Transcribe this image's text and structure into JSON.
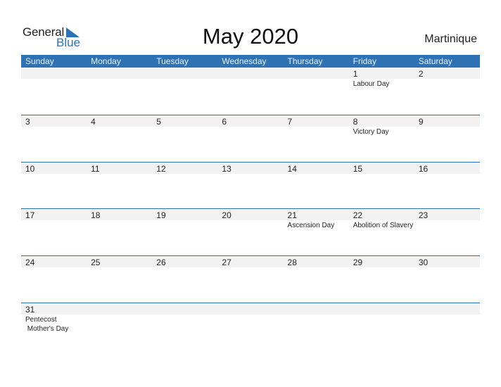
{
  "logo": {
    "line1": "General",
    "line2": "Blue",
    "accent": "#2a74b8"
  },
  "title": "May 2020",
  "country": "Martinique",
  "colors": {
    "header_bg": "#2e72b4",
    "number_row_bg": "#f2f2f2"
  },
  "weekdays": [
    "Sunday",
    "Monday",
    "Tuesday",
    "Wednesday",
    "Thursday",
    "Friday",
    "Saturday"
  ],
  "weeks": [
    {
      "days": [
        {
          "num": "",
          "events": []
        },
        {
          "num": "",
          "events": []
        },
        {
          "num": "",
          "events": []
        },
        {
          "num": "",
          "events": []
        },
        {
          "num": "",
          "events": []
        },
        {
          "num": "1",
          "events": [
            "Labour Day"
          ]
        },
        {
          "num": "2",
          "events": []
        }
      ]
    },
    {
      "days": [
        {
          "num": "3",
          "events": []
        },
        {
          "num": "4",
          "events": []
        },
        {
          "num": "5",
          "events": []
        },
        {
          "num": "6",
          "events": []
        },
        {
          "num": "7",
          "events": []
        },
        {
          "num": "8",
          "events": [
            "Victory Day"
          ]
        },
        {
          "num": "9",
          "events": []
        }
      ]
    },
    {
      "days": [
        {
          "num": "10",
          "events": []
        },
        {
          "num": "11",
          "events": []
        },
        {
          "num": "12",
          "events": []
        },
        {
          "num": "13",
          "events": []
        },
        {
          "num": "14",
          "events": []
        },
        {
          "num": "15",
          "events": []
        },
        {
          "num": "16",
          "events": []
        }
      ]
    },
    {
      "days": [
        {
          "num": "17",
          "events": []
        },
        {
          "num": "18",
          "events": []
        },
        {
          "num": "19",
          "events": []
        },
        {
          "num": "20",
          "events": []
        },
        {
          "num": "21",
          "events": [
            "Ascension Day"
          ]
        },
        {
          "num": "22",
          "events": [
            "Abolition of Slavery"
          ]
        },
        {
          "num": "23",
          "events": []
        }
      ]
    },
    {
      "days": [
        {
          "num": "24",
          "events": []
        },
        {
          "num": "25",
          "events": []
        },
        {
          "num": "26",
          "events": []
        },
        {
          "num": "27",
          "events": []
        },
        {
          "num": "28",
          "events": []
        },
        {
          "num": "29",
          "events": []
        },
        {
          "num": "30",
          "events": []
        }
      ]
    },
    {
      "days": [
        {
          "num": "31",
          "events": [
            "Pentecost",
            " Mother's Day"
          ]
        },
        {
          "num": "",
          "events": []
        },
        {
          "num": "",
          "events": []
        },
        {
          "num": "",
          "events": []
        },
        {
          "num": "",
          "events": []
        },
        {
          "num": "",
          "events": []
        },
        {
          "num": "",
          "events": []
        }
      ]
    }
  ]
}
